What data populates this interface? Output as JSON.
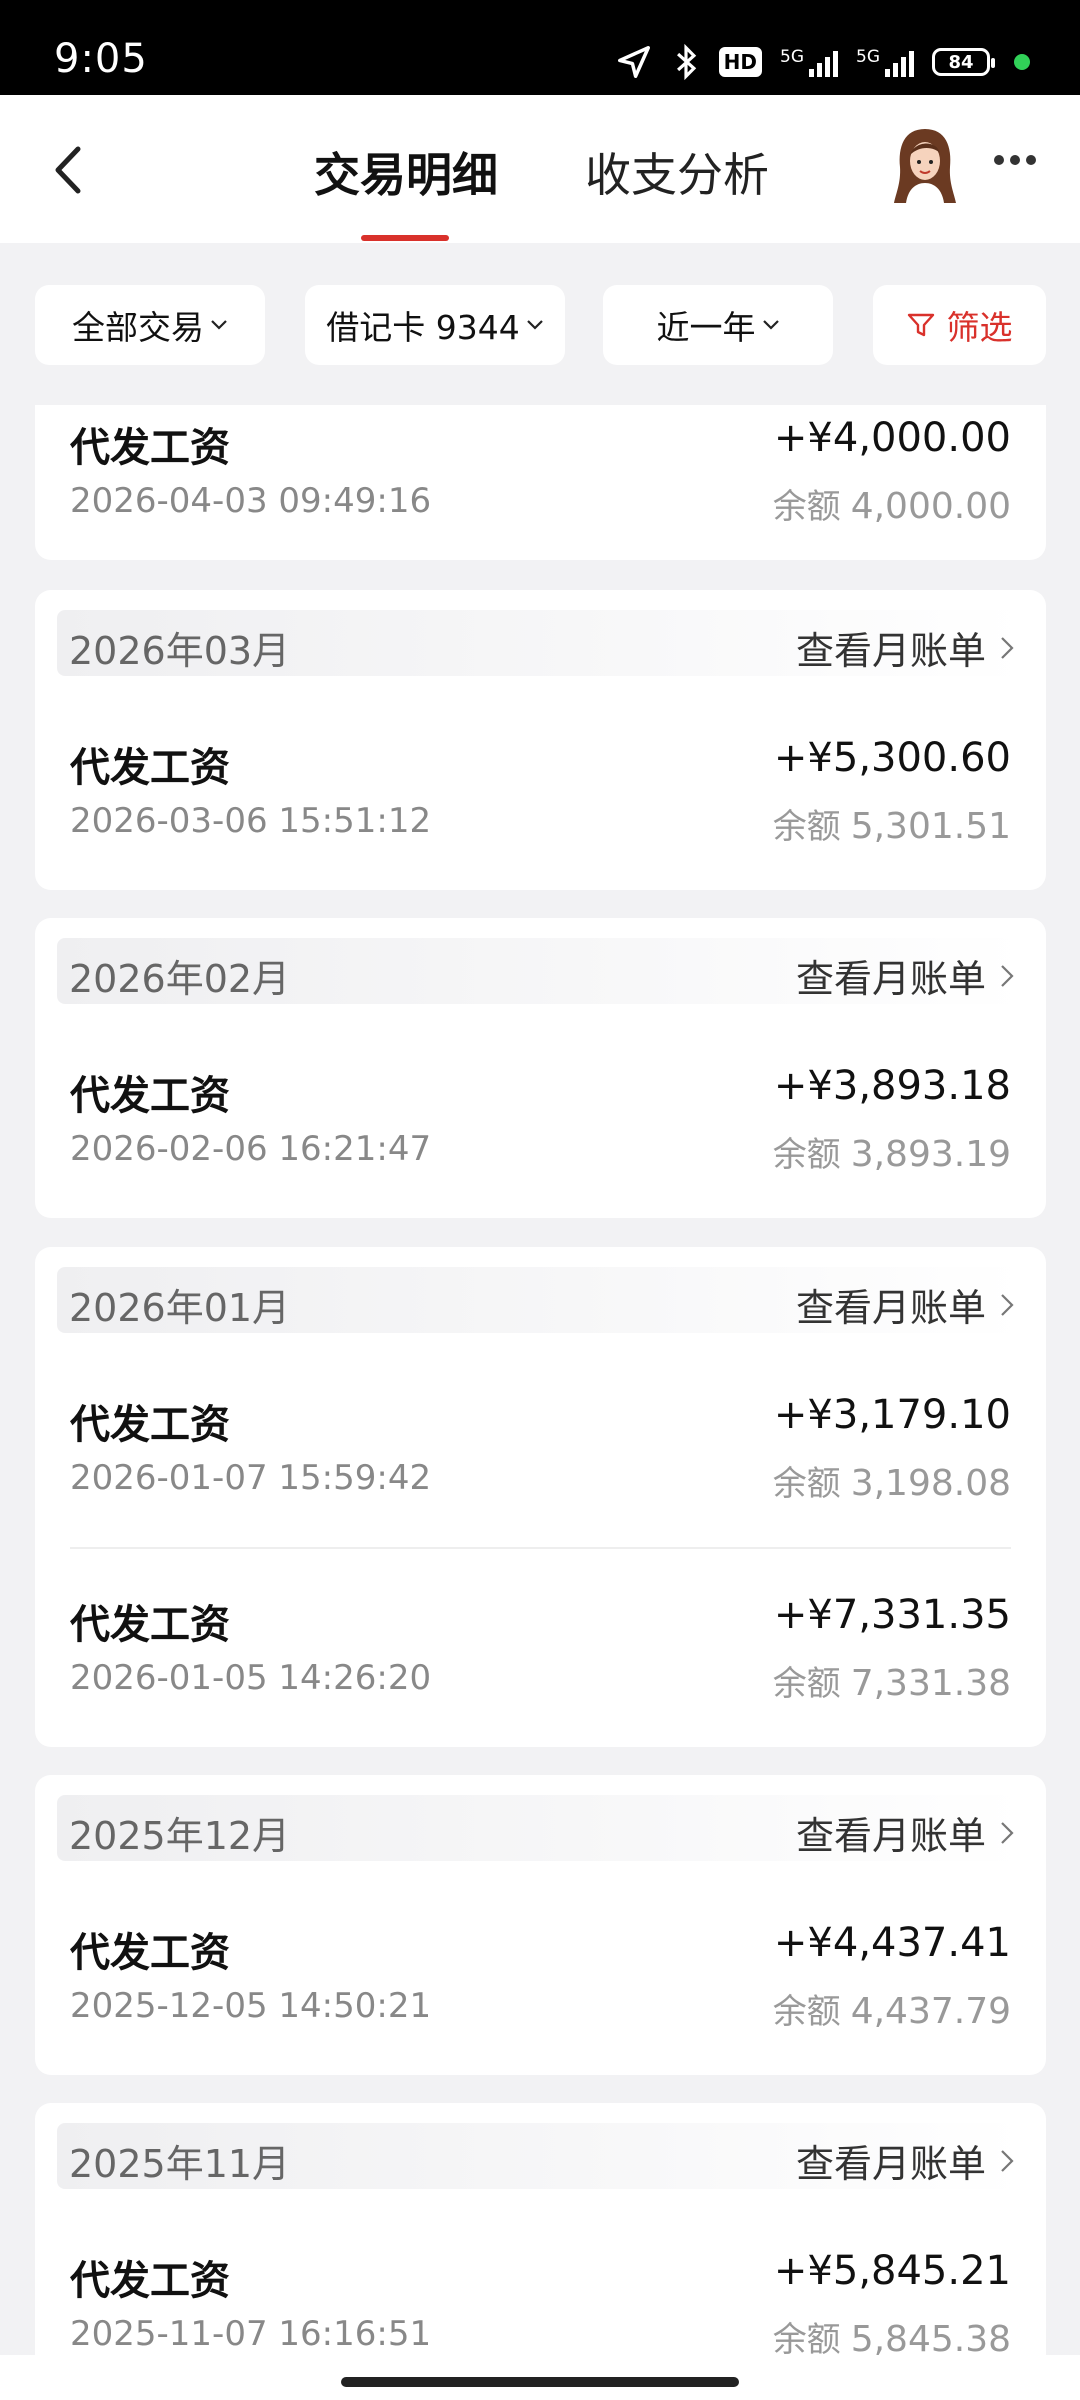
{
  "status_bar": {
    "time": "9:05",
    "hd_label": "HD",
    "net1": "5G",
    "net2": "5G",
    "battery": "84"
  },
  "nav": {
    "tab_active": "交易明细",
    "tab_inactive": "收支分析"
  },
  "filters": {
    "all": "全部交易",
    "card": "借记卡 9344",
    "period": "近一年",
    "filter": "筛选"
  },
  "balance_label": "余额",
  "bill_label": "查看月账单",
  "top_partial": {
    "name": "代发工资",
    "date": "2026-04-03 09:49:16",
    "amount": "+¥4,000.00",
    "balance": "4,000.00"
  },
  "months": [
    {
      "month": "2026年03月",
      "transactions": [
        {
          "name": "代发工资",
          "date": "2026-03-06 15:51:12",
          "amount": "+¥5,300.60",
          "balance": "5,301.51"
        }
      ]
    },
    {
      "month": "2026年02月",
      "transactions": [
        {
          "name": "代发工资",
          "date": "2026-02-06 16:21:47",
          "amount": "+¥3,893.18",
          "balance": "3,893.19"
        }
      ]
    },
    {
      "month": "2026年01月",
      "transactions": [
        {
          "name": "代发工资",
          "date": "2026-01-07 15:59:42",
          "amount": "+¥3,179.10",
          "balance": "3,198.08"
        },
        {
          "name": "代发工资",
          "date": "2026-01-05 14:26:20",
          "amount": "+¥7,331.35",
          "balance": "7,331.38"
        }
      ]
    },
    {
      "month": "2025年12月",
      "transactions": [
        {
          "name": "代发工资",
          "date": "2025-12-05 14:50:21",
          "amount": "+¥4,437.41",
          "balance": "4,437.79"
        }
      ]
    },
    {
      "month": "2025年11月",
      "transactions": [
        {
          "name": "代发工资",
          "date": "2025-11-07 16:16:51",
          "amount": "+¥5,845.21",
          "balance": "5,845.38"
        }
      ]
    }
  ],
  "colors": {
    "accent": "#d9312b",
    "background": "#f2f2f4"
  }
}
